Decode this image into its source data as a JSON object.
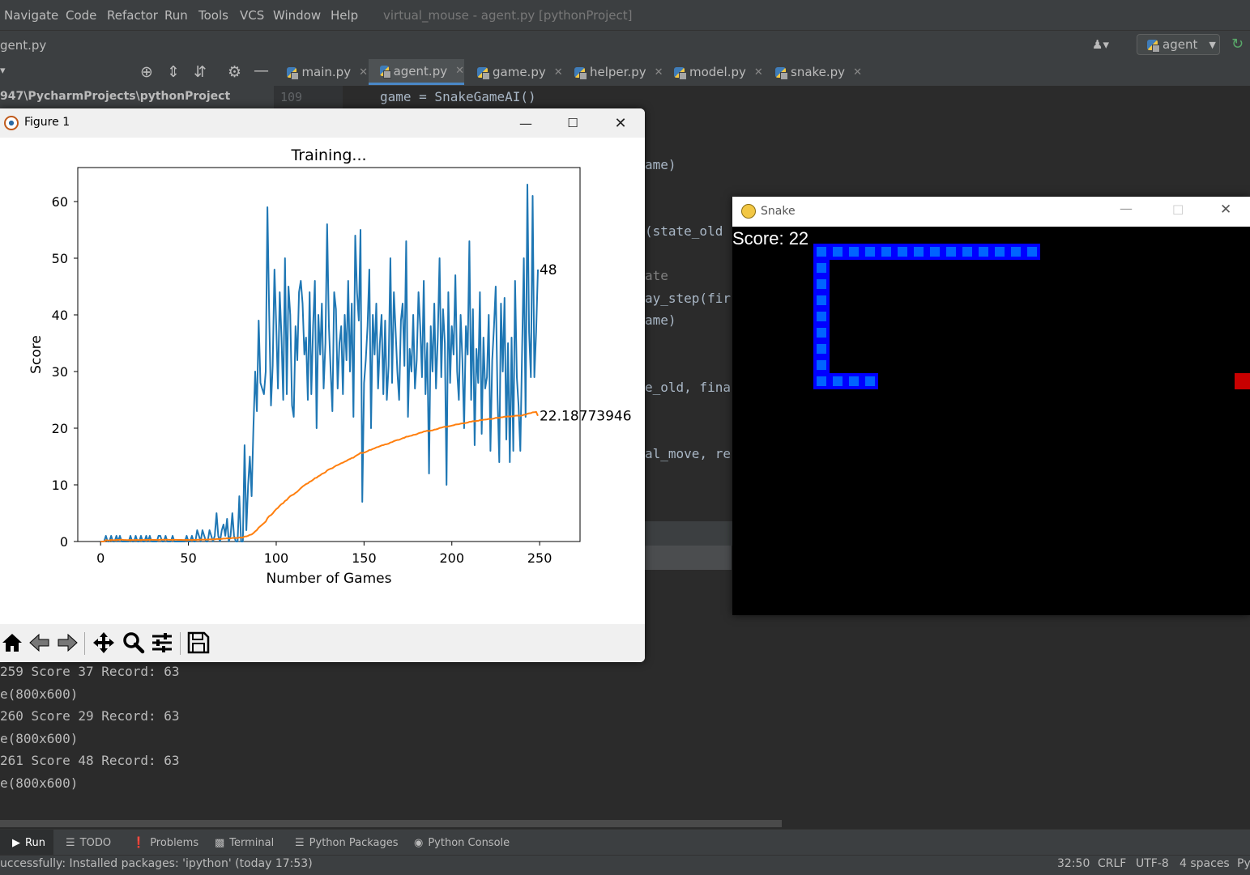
{
  "menubar": {
    "items": [
      "Navigate",
      "Code",
      "Refactor",
      "Run",
      "Tools",
      "VCS",
      "Window",
      "Help"
    ],
    "window_title": "virtual_mouse - agent.py [pythonProject]"
  },
  "navbar": {
    "breadcrumb": "gent.py",
    "run_config": "agent"
  },
  "tabs": [
    {
      "label": "main.py"
    },
    {
      "label": "agent.py"
    },
    {
      "label": "game.py"
    },
    {
      "label": "helper.py"
    },
    {
      "label": "model.py"
    },
    {
      "label": "snake.py"
    }
  ],
  "project_path": "947\\PycharmProjects\\pythonProject",
  "editor": {
    "line_number": "109",
    "line_109": "game = SnakeGameAI()",
    "frag_game1": "ame)",
    "frag_state_old": "(state_old",
    "frag_comment": "ate",
    "frag_play_step": "ay_step(fir",
    "frag_game2": "ame)",
    "frag_old_final": "e_old, fina",
    "frag_final_move": "al_move, re"
  },
  "console": {
    "lines": [
      "259 Score 37 Record: 63",
      "e(800x600)",
      "260 Score 29 Record: 63",
      "e(800x600)",
      "261 Score 48 Record: 63",
      "e(800x600)"
    ]
  },
  "bottom_tools": [
    "Run",
    "TODO",
    "Problems",
    "Terminal",
    "Python Packages",
    "Python Console"
  ],
  "status": {
    "message": "uccessfully: Installed packages: 'ipython' (today 17:53)",
    "position": "32:50",
    "line_sep": "CRLF",
    "encoding": "UTF-8",
    "indent": "4 spaces",
    "interpreter": "Py"
  },
  "figure_window": {
    "title": "Figure 1",
    "toolbar": [
      "home-icon",
      "back-icon",
      "forward-icon",
      "pan-icon",
      "zoom-icon",
      "configure-icon",
      "save-icon"
    ]
  },
  "snake_window": {
    "title": "Snake",
    "score_text": "Score: 22",
    "colors": {
      "snake_outer": "#0000ff",
      "snake_inner": "#0064ff",
      "food": "#c80000"
    }
  },
  "chart_data": {
    "type": "line",
    "title": "Training...",
    "xlabel": "Number of Games",
    "ylabel": "Score",
    "xlim": [
      -13,
      273
    ],
    "ylim": [
      0,
      66
    ],
    "xticks": [
      0,
      50,
      100,
      150,
      200,
      250
    ],
    "yticks": [
      0,
      10,
      20,
      30,
      40,
      50,
      60
    ],
    "grid": false,
    "colors": [
      "#1f77b4",
      "#ff7f0e"
    ],
    "end_labels": [
      "48",
      "22.18773946"
    ],
    "series": [
      {
        "name": "",
        "values": [
          0,
          0,
          0,
          1,
          0,
          0,
          1,
          0,
          0,
          1,
          0,
          1,
          0,
          0,
          0,
          0,
          0,
          1,
          0,
          0,
          1,
          0,
          0,
          1,
          0,
          0,
          1,
          0,
          1,
          0,
          0,
          0,
          0,
          1,
          1,
          0,
          0,
          1,
          0,
          0,
          0,
          1,
          0,
          0,
          0,
          0,
          0,
          0,
          0,
          1,
          0,
          0,
          1,
          0,
          0,
          2,
          1,
          0,
          2,
          1,
          0,
          0,
          2,
          1,
          0,
          1,
          5,
          1,
          0,
          2,
          3,
          1,
          4,
          0,
          1,
          5,
          1,
          0,
          0,
          8,
          0,
          0,
          17,
          2,
          10,
          15,
          8,
          20,
          30,
          23,
          39,
          28,
          27,
          26,
          30,
          59,
          40,
          24,
          31,
          48,
          38,
          27,
          44,
          36,
          25,
          50,
          26,
          45,
          40,
          24,
          22,
          38,
          32,
          44,
          46,
          42,
          33,
          36,
          25,
          44,
          26,
          38,
          46,
          20,
          40,
          33,
          42,
          27,
          35,
          56,
          38,
          30,
          23,
          44,
          41,
          27,
          35,
          38,
          26,
          40,
          32,
          46,
          30,
          42,
          22,
          54,
          44,
          39,
          55,
          7,
          28,
          32,
          38,
          48,
          20,
          40,
          33,
          42,
          27,
          35,
          40,
          26,
          39,
          25,
          31,
          50,
          28,
          44,
          37,
          30,
          25,
          39,
          42,
          31,
          53,
          22,
          34,
          30,
          40,
          27,
          32,
          44,
          38,
          29,
          46,
          26,
          35,
          12,
          38,
          30,
          42,
          27,
          36,
          50,
          29,
          41,
          35,
          10,
          44,
          28,
          38,
          33,
          47,
          30,
          25,
          40,
          32,
          20,
          38,
          33,
          53,
          25,
          41,
          17,
          34,
          28,
          44,
          19,
          36,
          27,
          29,
          40,
          16,
          32,
          38,
          45,
          26,
          14,
          42,
          30,
          43,
          18,
          35,
          14,
          36,
          16,
          46,
          29,
          24,
          16,
          34,
          50,
          22,
          63,
          37,
          29,
          61,
          29,
          37,
          48
        ]
      },
      {
        "name": "",
        "values": [
          0,
          0,
          0,
          0.25,
          0.2,
          0.17,
          0.29,
          0.25,
          0.22,
          0.3,
          0.27,
          0.33,
          0.31,
          0.29,
          0.27,
          0.25,
          0.24,
          0.28,
          0.26,
          0.25,
          0.29,
          0.27,
          0.26,
          0.29,
          0.28,
          0.27,
          0.3,
          0.29,
          0.31,
          0.3,
          0.29,
          0.28,
          0.27,
          0.29,
          0.31,
          0.31,
          0.3,
          0.32,
          0.31,
          0.3,
          0.29,
          0.31,
          0.3,
          0.3,
          0.29,
          0.28,
          0.28,
          0.27,
          0.27,
          0.28,
          0.27,
          0.27,
          0.28,
          0.28,
          0.27,
          0.31,
          0.32,
          0.31,
          0.34,
          0.35,
          0.34,
          0.34,
          0.37,
          0.37,
          0.37,
          0.38,
          0.45,
          0.46,
          0.45,
          0.47,
          0.51,
          0.52,
          0.57,
          0.56,
          0.57,
          0.63,
          0.64,
          0.63,
          0.62,
          0.71,
          0.7,
          0.69,
          0.89,
          0.9,
          1.01,
          1.17,
          1.25,
          1.47,
          1.79,
          2.03,
          2.44,
          2.71,
          2.97,
          3.23,
          3.52,
          4.1,
          4.48,
          4.65,
          4.95,
          5.37,
          5.71,
          5.94,
          6.32,
          6.61,
          6.77,
          7.16,
          7.35,
          7.7,
          8.02,
          8.18,
          8.31,
          8.59,
          8.8,
          9.1,
          9.42,
          9.7,
          9.91,
          10.14,
          10.26,
          10.54,
          10.67,
          10.9,
          11.19,
          11.26,
          11.51,
          11.69,
          11.93,
          12.05,
          12.22,
          12.54,
          12.73,
          12.86,
          12.94,
          13.17,
          13.38,
          13.48,
          13.64,
          13.82,
          13.91,
          14.1,
          14.23,
          14.44,
          14.55,
          14.74,
          14.79,
          15.06,
          15.25,
          15.41,
          15.66,
          15.61,
          15.69,
          15.8,
          15.95,
          16.16,
          16.19,
          16.35,
          16.45,
          16.61,
          16.68,
          16.81,
          16.96,
          17.01,
          17.14,
          17.18,
          17.27,
          17.47,
          17.54,
          17.71,
          17.83,
          17.91,
          17.95,
          18.08,
          18.23,
          18.3,
          18.5,
          18.52,
          18.61,
          18.67,
          18.81,
          18.85,
          18.93,
          19.1,
          19.2,
          19.25,
          19.42,
          19.46,
          19.55,
          19.47,
          19.57,
          19.62,
          19.74,
          19.78,
          19.87,
          20.04,
          20.08,
          20.19,
          20.27,
          20.21,
          20.33,
          20.37,
          20.46,
          20.51,
          20.64,
          20.68,
          20.7,
          20.8,
          20.85,
          20.85,
          20.93,
          20.98,
          21.13,
          21.14,
          21.24,
          21.22,
          21.28,
          21.3,
          21.43,
          21.42,
          21.5,
          21.52,
          21.56,
          21.64,
          21.61,
          21.65,
          21.72,
          21.83,
          21.85,
          21.82,
          21.91,
          21.94,
          22.04,
          22.02,
          22.08,
          22.04,
          22.1,
          22.07,
          22.2,
          22.22,
          22.23,
          22.19,
          22.25,
          22.37,
          22.37,
          22.56,
          22.63,
          22.66,
          22.8,
          22.82,
          22.88,
          22.19
        ]
      }
    ]
  }
}
